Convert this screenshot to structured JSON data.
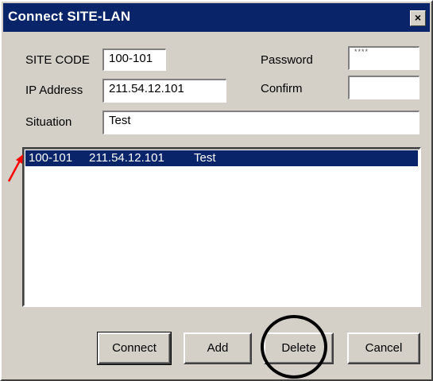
{
  "window": {
    "title": "Connect SITE-LAN",
    "close_glyph": "×"
  },
  "form": {
    "site_code_label": "SITE CODE",
    "site_code_value": "100-101",
    "ip_label": "IP Address",
    "ip_value": "211.54.12.101",
    "situation_label": "Situation",
    "situation_value": "Test",
    "password_label": "Password",
    "password_value": "****",
    "confirm_label": "Confirm",
    "confirm_value": ""
  },
  "list": {
    "rows": [
      {
        "site_code": "100-101",
        "ip": "211.54.12.101",
        "situation": "Test",
        "selected": true
      }
    ]
  },
  "buttons": {
    "connect": "Connect",
    "add": "Add",
    "delete": "Delete",
    "cancel": "Cancel"
  },
  "annotations": {
    "arrow_color": "#ff0000",
    "circle_color": "#000000",
    "circled_button": "delete"
  },
  "colors": {
    "titlebar": "#0a246a",
    "selection": "#0a246a",
    "face": "#d4d0c8"
  }
}
